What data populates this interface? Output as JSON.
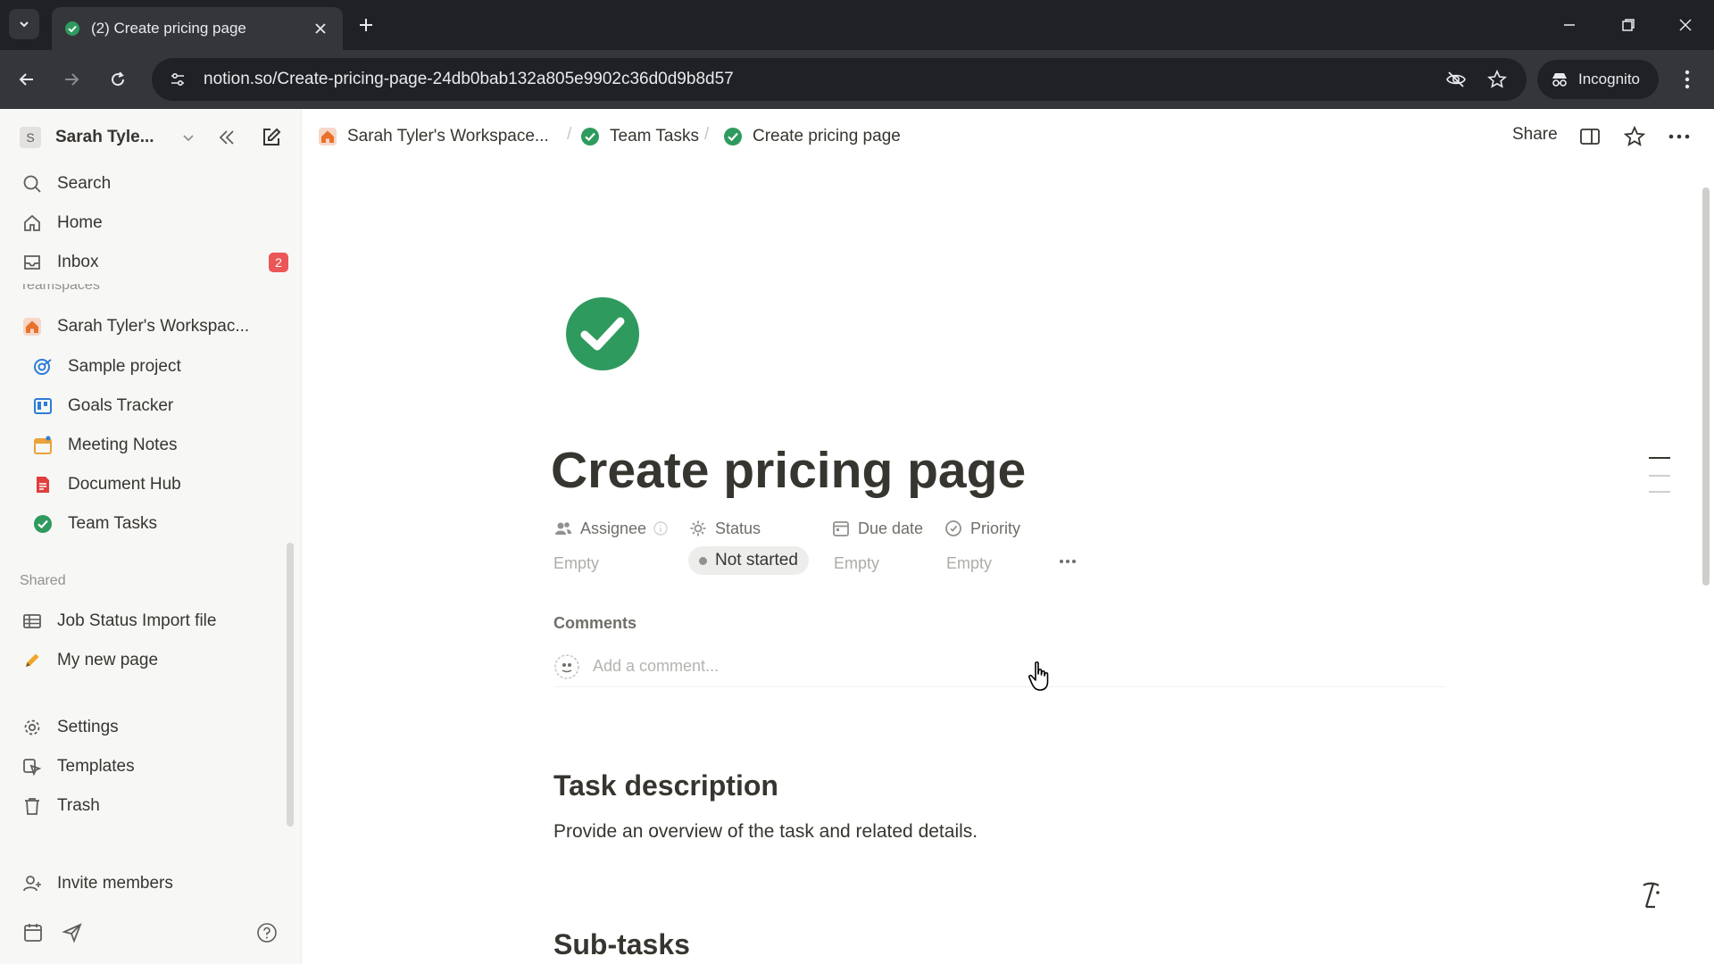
{
  "browser": {
    "tab_title": "(2) Create pricing page",
    "url": "notion.so/Create-pricing-page-24db0bab132a805e9902c36d0d9b8d57",
    "incognito_label": "Incognito"
  },
  "sidebar": {
    "workspace_avatar": "S",
    "workspace_name": "Sarah Tyle...",
    "nav": {
      "search": "Search",
      "home": "Home",
      "inbox": "Inbox",
      "inbox_badge": "2"
    },
    "teamspaces_label": "Teamspaces",
    "workspace_root": "Sarah Tyler's Workspac...",
    "teamspace_items": [
      {
        "label": "Sample project",
        "icon": "target-icon",
        "color": "#2e7cd6"
      },
      {
        "label": "Goals Tracker",
        "icon": "board-icon",
        "color": "#2e7cd6"
      },
      {
        "label": "Meeting Notes",
        "icon": "calendar-icon",
        "color": "#e8a33b"
      },
      {
        "label": "Document Hub",
        "icon": "document-icon",
        "color": "#e03e3e"
      },
      {
        "label": "Team Tasks",
        "icon": "check-circle-icon",
        "color": "#2f9a5e"
      }
    ],
    "shared_label": "Shared",
    "shared_items": [
      {
        "label": "Job Status Import file",
        "icon": "table-icon"
      },
      {
        "label": "My new page",
        "icon": "pencil-icon"
      }
    ],
    "utility_items": {
      "settings": "Settings",
      "templates": "Templates",
      "trash": "Trash"
    },
    "invite": "Invite members"
  },
  "topbar": {
    "breadcrumbs": [
      "Sarah Tyler's Workspace...",
      "Team Tasks",
      "Create pricing page"
    ],
    "share": "Share"
  },
  "page": {
    "title": "Create pricing page",
    "properties": {
      "assignee": {
        "label": "Assignee",
        "value": "Empty"
      },
      "status": {
        "label": "Status",
        "value": "Not started"
      },
      "due_date": {
        "label": "Due date",
        "value": "Empty"
      },
      "priority": {
        "label": "Priority",
        "value": "Empty"
      }
    },
    "comments_label": "Comments",
    "comment_placeholder": "Add a comment...",
    "task_description_heading": "Task description",
    "task_description_text": "Provide an overview of the task and related details.",
    "subtasks_heading": "Sub-tasks"
  },
  "colors": {
    "accent_green": "#2f9a5e",
    "badge_red": "#eb5757"
  }
}
